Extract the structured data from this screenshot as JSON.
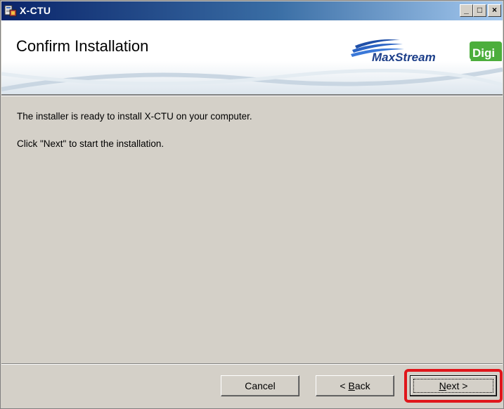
{
  "window": {
    "title": "X-CTU",
    "controls": {
      "minimize": "_",
      "maximize": "□",
      "close": "×"
    }
  },
  "header": {
    "title": "Confirm Installation",
    "logos": [
      "MaxStream",
      "Digi"
    ]
  },
  "body": {
    "line1": "The installer is ready to install X-CTU on your computer.",
    "line2": "Click \"Next\" to start the installation."
  },
  "buttons": {
    "cancel": "Cancel",
    "back_mnemonic": "B",
    "back_rest": "ack",
    "back_prefix": "< ",
    "next_mnemonic": "N",
    "next_rest": "ext >"
  },
  "colors": {
    "titlebar_start": "#0a246a",
    "titlebar_end": "#a6caf0",
    "highlight": "#e0161b",
    "dialog_bg": "#d4d0c8"
  },
  "icons": [
    "installer-app-icon",
    "maxstream-logo",
    "digi-logo"
  ]
}
